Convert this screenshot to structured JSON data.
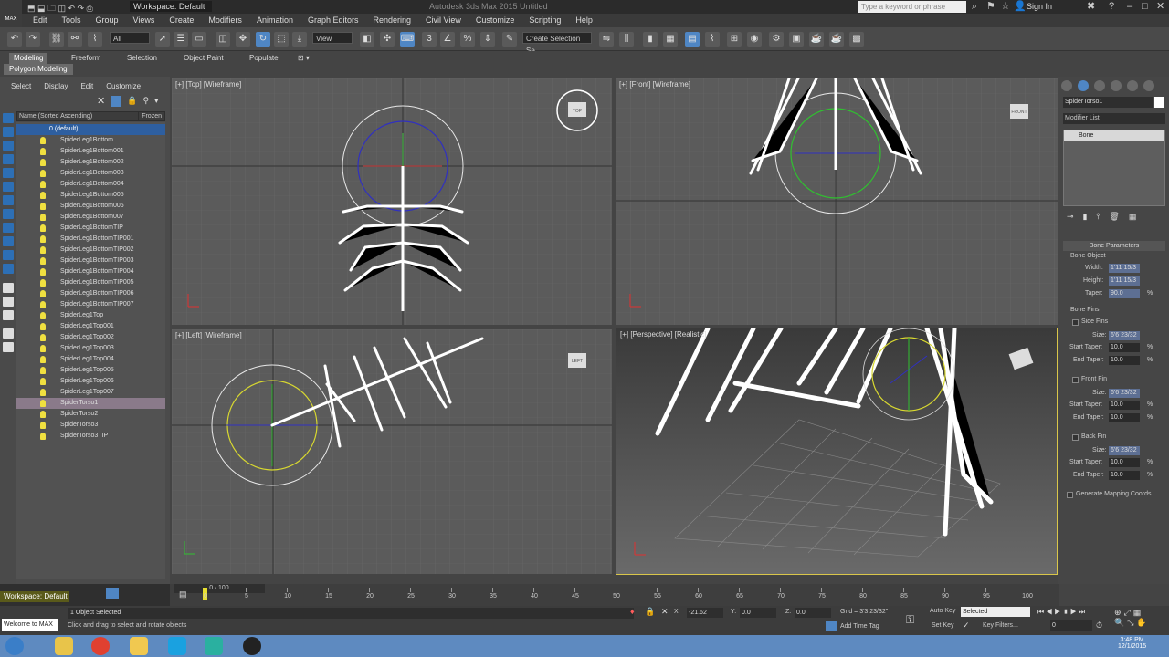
{
  "titlebar": {
    "app_badge": "MAX",
    "workspace": "Workspace: Default",
    "title": "Autodesk 3ds Max 2015  Untitled",
    "search_placeholder": "Type a keyword or phrase",
    "sign_in": "Sign In"
  },
  "menu": [
    "Edit",
    "Tools",
    "Group",
    "Views",
    "Create",
    "Modifiers",
    "Animation",
    "Graph Editors",
    "Rendering",
    "Civil View",
    "Customize",
    "Scripting",
    "Help"
  ],
  "toolbar": {
    "selection_filter": "All",
    "ref_coord": "View",
    "named_selection": "Create Selection Se"
  },
  "ribbon": {
    "tabs": [
      "Modeling",
      "Freeform",
      "Selection",
      "Object Paint",
      "Populate"
    ],
    "sub_tab": "Polygon Modeling"
  },
  "explorer": {
    "menu": [
      "Select",
      "Display",
      "Edit",
      "Customize"
    ],
    "column_name": "Name (Sorted Ascending)",
    "column_frozen": "Frozen",
    "root": "0 (default)",
    "items": [
      "SpiderLeg1Bottom",
      "SpiderLeg1Bottom001",
      "SpiderLeg1Bottom002",
      "SpiderLeg1Bottom003",
      "SpiderLeg1Bottom004",
      "SpiderLeg1Bottom005",
      "SpiderLeg1Bottom006",
      "SpiderLeg1Bottom007",
      "SpiderLeg1BottomTIP",
      "SpiderLeg1BottomTIP001",
      "SpiderLeg1BottomTIP002",
      "SpiderLeg1BottomTIP003",
      "SpiderLeg1BottomTIP004",
      "SpiderLeg1BottomTIP005",
      "SpiderLeg1BottomTIP006",
      "SpiderLeg1BottomTIP007",
      "SpiderLeg1Top",
      "SpiderLeg1Top001",
      "SpiderLeg1Top002",
      "SpiderLeg1Top003",
      "SpiderLeg1Top004",
      "SpiderLeg1Top005",
      "SpiderLeg1Top006",
      "SpiderLeg1Top007",
      "SpiderTorso1",
      "SpiderTorso2",
      "SpiderTorso3",
      "SpiderTorso3TIP"
    ],
    "selected_index": 24
  },
  "viewports": {
    "top": "[+] [Top] [Wireframe]",
    "front": "[+] [Front] [Wireframe]",
    "left": "[+] [Left] [Wireframe]",
    "persp": "[+] [Perspective] [Realistic]"
  },
  "viewcube": {
    "top": "TOP",
    "front": "FRONT",
    "left": "LEFT"
  },
  "cmd": {
    "object_name": "SpiderTorso1",
    "modifier_list": "Modifier List",
    "stack_item": "Bone",
    "rollout": "Bone Parameters",
    "bone_object": "Bone Object",
    "width_label": "Width:",
    "width": "1'11 15/3",
    "height_label": "Height:",
    "height": "1'11 15/3",
    "taper_label": "Taper:",
    "taper": "90.0",
    "pct": "%",
    "bone_fins": "Bone Fins",
    "side_fins": "Side Fins",
    "front_fin": "Front Fin",
    "back_fin": "Back Fin",
    "size_label": "Size:",
    "size": "6'6 23/32",
    "start_taper_label": "Start Taper:",
    "start_taper": "10.0",
    "end_taper_label": "End Taper:",
    "end_taper": "10.0",
    "gen_map": "Generate Mapping Coords."
  },
  "timeline": {
    "frame": "0 / 100",
    "ticks": [
      "0",
      "5",
      "10",
      "15",
      "20",
      "25",
      "30",
      "35",
      "40",
      "45",
      "50",
      "55",
      "60",
      "65",
      "70",
      "75",
      "80",
      "85",
      "90",
      "95",
      "100"
    ]
  },
  "status": {
    "workspace": "Workspace: Default",
    "welcome": "Welcome to MAX",
    "selected": "1 Object Selected",
    "prompt": "Click and drag to select and rotate objects",
    "x_label": "X:",
    "x": "-21.62",
    "y_label": "Y:",
    "y": "0.0",
    "z_label": "Z:",
    "z": "0.0",
    "grid": "Grid = 3'3 23/32\"",
    "add_time_tag": "Add Time Tag",
    "auto_key": "Auto Key",
    "set_key": "Set Key",
    "key_mode": "Selected",
    "key_filters": "Key Filters...",
    "frame": "0"
  },
  "taskbar": {
    "time": "3:48 PM",
    "date": "12/1/2015"
  },
  "colors": {
    "accent": "#4f86c4",
    "selected_row": "#8a7a8a",
    "viewport_active": "#d9c64a"
  }
}
